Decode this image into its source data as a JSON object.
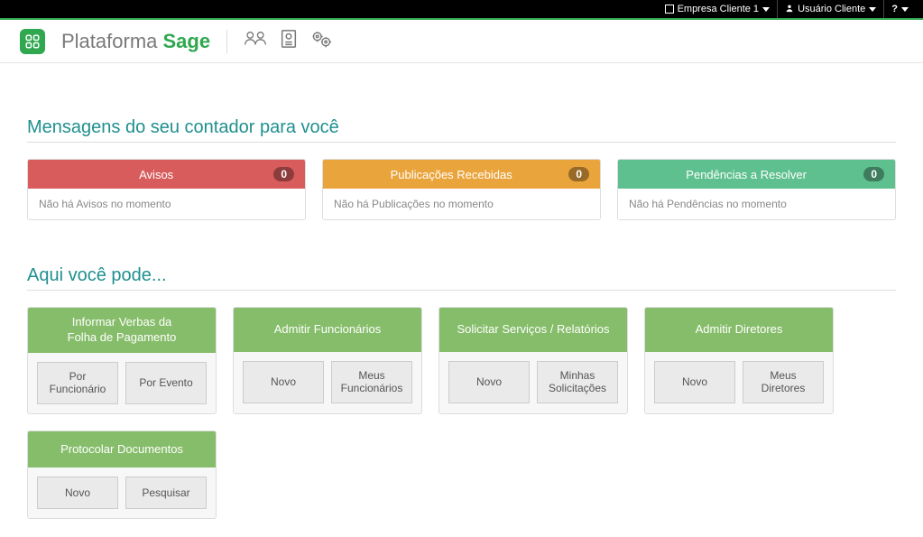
{
  "topbar": {
    "company": "Empresa Cliente 1",
    "user": "Usuário Cliente",
    "help": "?"
  },
  "header": {
    "logo_text_1": "Plataforma ",
    "logo_text_2": "Sage"
  },
  "messages_section": {
    "title": "Mensagens do seu contador para você",
    "cards": [
      {
        "title": "Avisos",
        "count": "0",
        "body": "Não há Avisos no momento"
      },
      {
        "title": "Publicações Recebidas",
        "count": "0",
        "body": "Não há Publicações no momento"
      },
      {
        "title": "Pendências a Resolver",
        "count": "0",
        "body": "Não há Pendências no momento"
      }
    ]
  },
  "actions_section": {
    "title": "Aqui você pode...",
    "cards": [
      {
        "title": "Informar Verbas da\nFolha de Pagamento",
        "buttons": [
          "Por Funcionário",
          "Por Evento"
        ]
      },
      {
        "title": "Admitir Funcionários",
        "buttons": [
          "Novo",
          "Meus Funcionários"
        ]
      },
      {
        "title": "Solicitar Serviços / Relatórios",
        "buttons": [
          "Novo",
          "Minhas Solicitações"
        ]
      },
      {
        "title": "Admitir Diretores",
        "buttons": [
          "Novo",
          "Meus Diretores"
        ]
      },
      {
        "title": "Protocolar Documentos",
        "buttons": [
          "Novo",
          "Pesquisar"
        ]
      }
    ]
  }
}
